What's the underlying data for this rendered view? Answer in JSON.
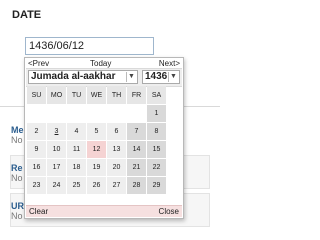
{
  "field": {
    "label": "DATE",
    "value": "1436/06/12"
  },
  "background": {
    "items": [
      {
        "title": "Me",
        "sub": "No"
      },
      {
        "title": "Re",
        "sub": "No"
      },
      {
        "title": "UR",
        "sub": "No alias"
      }
    ]
  },
  "calendar": {
    "nav": {
      "prev": "<Prev",
      "today": "Today",
      "next": "Next>"
    },
    "month": "Jumada al-aakhar",
    "year": "1436",
    "weekdays": [
      "SU",
      "MO",
      "TU",
      "WE",
      "TH",
      "FR",
      "SA"
    ],
    "weeks": [
      [
        "",
        "",
        "",
        "",
        "",
        "",
        "1"
      ],
      [
        "2",
        "3",
        "4",
        "5",
        "6",
        "7",
        "8"
      ],
      [
        "9",
        "10",
        "11",
        "12",
        "13",
        "14",
        "15"
      ],
      [
        "16",
        "17",
        "18",
        "19",
        "20",
        "21",
        "22"
      ],
      [
        "23",
        "24",
        "25",
        "26",
        "27",
        "28",
        "29"
      ]
    ],
    "current_day": "3",
    "selected_day": "12",
    "footer": {
      "clear": "Clear",
      "close": "Close"
    }
  },
  "colors": {
    "input_border": "#9fb6cd",
    "selected_day": "#f5d3d3",
    "weekend_day": "#d9d9d9",
    "footer_bg": "#f6e0e0"
  },
  "icons": {
    "dropdown": "chevron-down-icon"
  }
}
